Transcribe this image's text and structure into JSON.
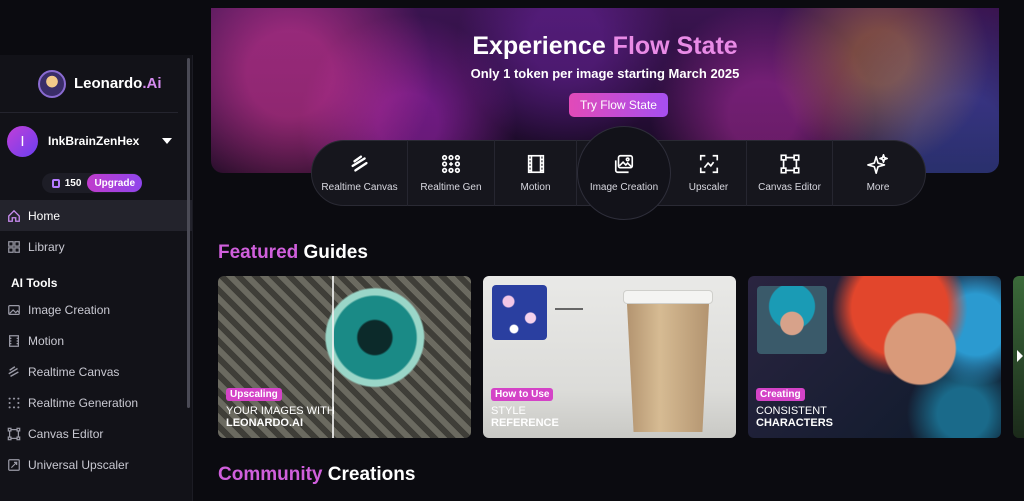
{
  "brand": {
    "name_prefix": "Leonardo",
    "name_suffix": ".Ai"
  },
  "user": {
    "initial": "I",
    "name": "InkBrainZenHex",
    "tokens": "150",
    "upgrade_label": "Upgrade"
  },
  "sidebar": {
    "items": [
      {
        "label": "Home",
        "icon": "home-icon"
      },
      {
        "label": "Library",
        "icon": "grid-icon"
      }
    ],
    "tools_title": "AI Tools",
    "tools": [
      {
        "label": "Image Creation",
        "icon": "image-icon"
      },
      {
        "label": "Motion",
        "icon": "film-icon"
      },
      {
        "label": "Realtime Canvas",
        "icon": "brush-icon"
      },
      {
        "label": "Realtime Generation",
        "icon": "dots-grid-icon"
      },
      {
        "label": "Canvas Editor",
        "icon": "frame-icon"
      },
      {
        "label": "Universal Upscaler",
        "icon": "upscale-icon"
      }
    ]
  },
  "hero": {
    "title_prefix": "Experience ",
    "title_accent": "Flow State",
    "subtitle": "Only 1 token per image starting March 2025",
    "button": "Try Flow State"
  },
  "toolbar": {
    "items": [
      {
        "label": "Realtime Canvas",
        "icon": "brush-icon"
      },
      {
        "label": "Realtime Gen",
        "icon": "dots-grid-icon"
      },
      {
        "label": "Motion",
        "icon": "film-icon"
      },
      {
        "label": "Image Creation",
        "icon": "image-icon"
      },
      {
        "label": "Upscaler",
        "icon": "upscale-icon"
      },
      {
        "label": "Canvas Editor",
        "icon": "frame-icon"
      },
      {
        "label": "More",
        "icon": "sparkle-icon"
      }
    ]
  },
  "featured": {
    "accent": "Featured",
    "rest": " Guides"
  },
  "guides": [
    {
      "tag": "Upscaling",
      "line1": "YOUR IMAGES WITH",
      "line2": "LEONARDO.AI"
    },
    {
      "tag": "How to Use",
      "line1": "STYLE",
      "line2": "REFERENCE"
    },
    {
      "tag": "Creating",
      "line1": "CONSISTENT",
      "line2": "CHARACTERS"
    }
  ],
  "community": {
    "accent": "Community",
    "rest": " Creations"
  }
}
